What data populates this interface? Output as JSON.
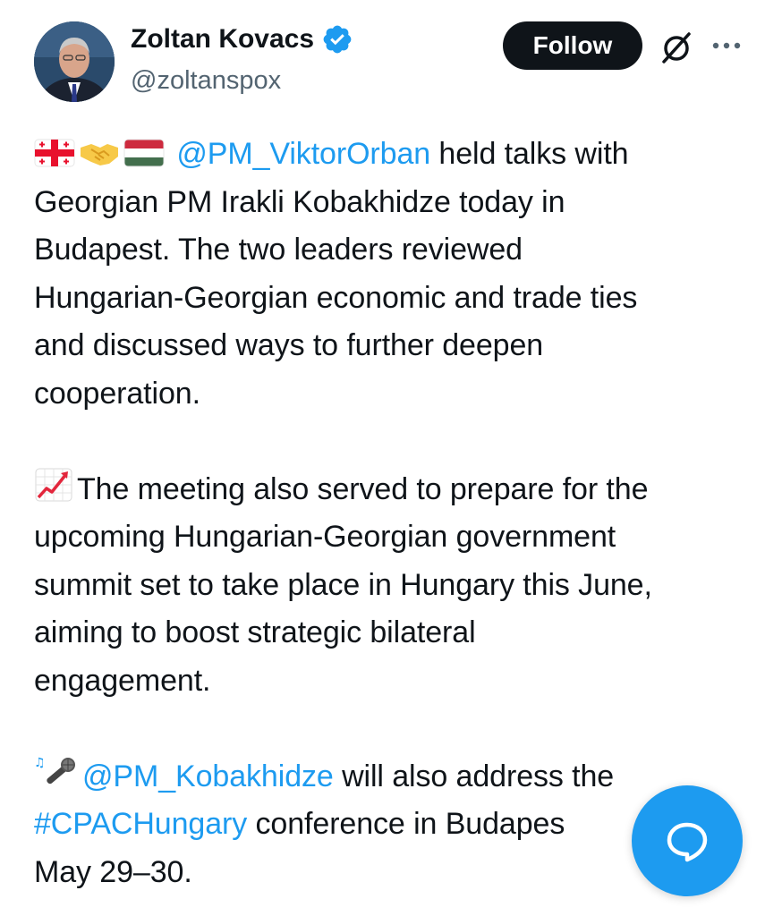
{
  "author": {
    "display_name": "Zoltan Kovacs",
    "handle": "@zoltanspox",
    "verified": true
  },
  "actions": {
    "follow_label": "Follow"
  },
  "tweet": {
    "p1": {
      "mention": "@PM_ViktorOrban",
      "l1_rest": " held talks with",
      "l2": "Georgian PM Irakli Kobakhidze today in",
      "l3": "Budapest. The two leaders reviewed",
      "l4": "Hungarian-Georgian economic and trade ties",
      "l5": "and discussed ways to further deepen",
      "l6": "cooperation."
    },
    "p2": {
      "l1": "The meeting also served to prepare for the",
      "l2": "upcoming Hungarian-Georgian government",
      "l3": "summit set to take place in Hungary this June,",
      "l4": "aiming to boost strategic bilateral",
      "l5": "engagement."
    },
    "p3": {
      "mention": "@PM_Kobakhidze",
      "l1_rest": " will also address the",
      "hashtag": "#CPACHungary",
      "l2_rest": " conference in Budapes",
      "l3": "May 29–30."
    }
  },
  "colors": {
    "link": "#1d9bf0",
    "text": "#0f1419",
    "secondary": "#536471",
    "follow_bg": "#0f1419",
    "fab": "#1d9bf0"
  },
  "icons": [
    "verified-badge-icon",
    "georgia-flag-icon",
    "handshake-icon",
    "hungary-flag-icon",
    "chart-increasing-icon",
    "microphone-icon",
    "grok-icon",
    "more-icon",
    "reply-icon"
  ]
}
